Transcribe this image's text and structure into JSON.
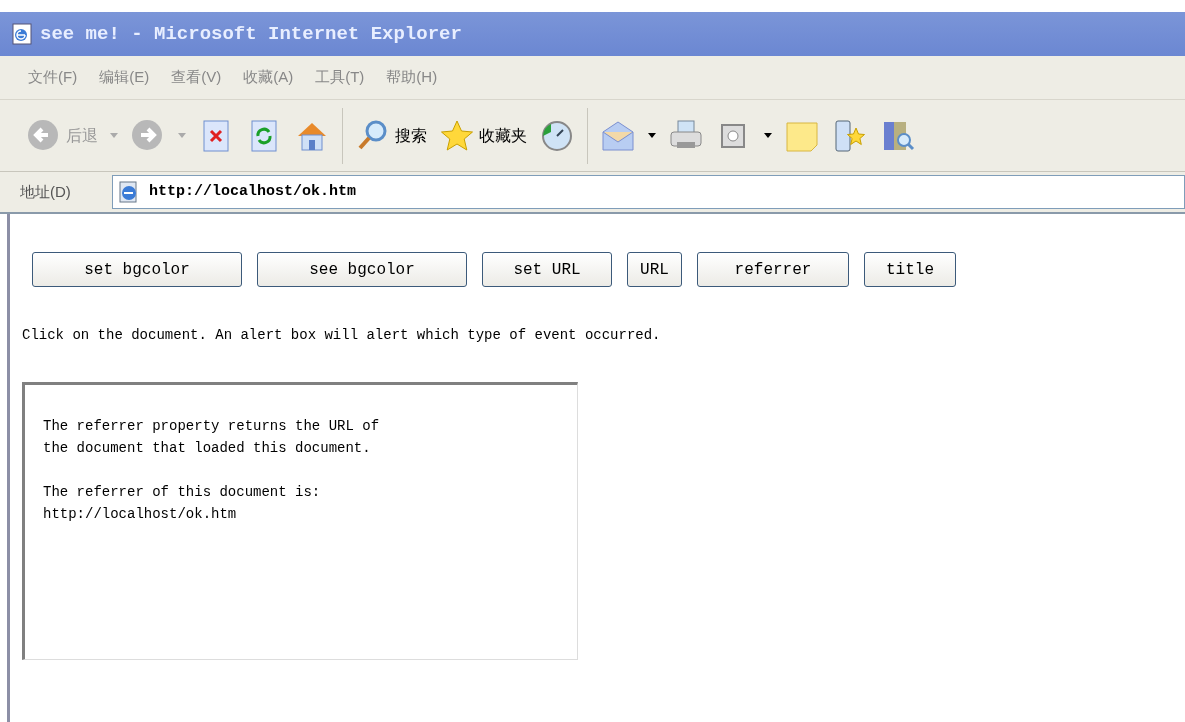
{
  "window": {
    "title": "see me! - Microsoft Internet Explorer"
  },
  "menu": [
    "文件(F)",
    "编辑(E)",
    "查看(V)",
    "收藏(A)",
    "工具(T)",
    "帮助(H)"
  ],
  "toolbar": [
    {
      "kind": "back",
      "label": "后退"
    },
    {
      "kind": "forward"
    },
    {
      "kind": "stop"
    },
    {
      "kind": "refresh"
    },
    {
      "kind": "home"
    },
    {
      "kind": "separator"
    },
    {
      "kind": "search",
      "label": "搜索"
    },
    {
      "kind": "favorites",
      "label": "收藏夹"
    },
    {
      "kind": "history"
    },
    {
      "kind": "separator"
    },
    {
      "kind": "mail"
    },
    {
      "kind": "print"
    },
    {
      "kind": "edit"
    },
    {
      "kind": "note"
    },
    {
      "kind": "messenger"
    },
    {
      "kind": "research"
    }
  ],
  "address": {
    "label": "地址(D)",
    "url": "http://localhost/ok.htm"
  },
  "buttons": [
    "set bgcolor",
    "see bgcolor",
    "set URL",
    "URL",
    "referrer",
    "title"
  ],
  "instruction": "Click on the document. An alert box will alert which type of event occurred.",
  "box": {
    "paragraphs": [
      "The referrer property returns the URL of\nthe document that loaded this document.",
      "The referrer of this document is:\nhttp://localhost/ok.htm"
    ]
  }
}
